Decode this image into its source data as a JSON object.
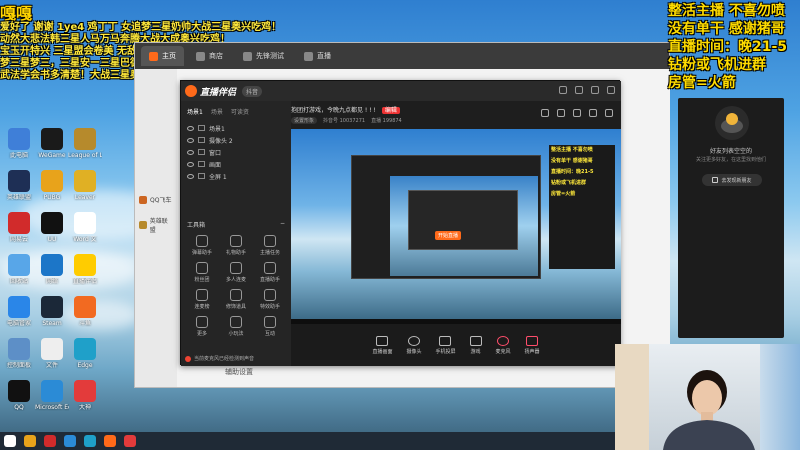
{
  "danmaku": [
    "爱好了 谢谢 1ye4 鸡丁丁 女追梦三星奶帅大战三星奥兴吃鸡！",
    "动然大悲法韩三星人马万马奔腾大战大成奥兴吃鸡！",
    "宝玉开特兴 三星盟会卷美 无敌9000血亚索一菜双吃鸡！！！",
    "梦三星梦三，三星安ー三星巴德奥兴吃鸡！",
    "武法学会书多清楚！大战三星奥兴吃鸡！"
  ],
  "danmaku_big": "嘎嘎",
  "desktop_icons": [
    {
      "label": "此电脑",
      "color": "#3f7fd8"
    },
    {
      "label": "WeGame",
      "color": "#1a1a1a"
    },
    {
      "label": "League of Legends",
      "color": "#b68a2c"
    },
    {
      "label": "英雄联盟",
      "color": "#1e2f55"
    },
    {
      "label": "PUBG",
      "color": "#e8a31b"
    },
    {
      "label": "Leaver",
      "color": "#e0b024"
    },
    {
      "label": "网易云",
      "color": "#d12b2b"
    },
    {
      "label": "UU",
      "color": "#111111"
    },
    {
      "label": "Word 文",
      "color": "#ffffff"
    },
    {
      "label": "回收站",
      "color": "#58a6e8"
    },
    {
      "label": "网络",
      "color": "#1c76c8"
    },
    {
      "label": "直播伴侣",
      "color": "#ffcc00"
    },
    {
      "label": "电脑管家",
      "color": "#2a86e8"
    },
    {
      "label": "Steam",
      "color": "#1b2838"
    },
    {
      "label": "斗鱼",
      "color": "#f26a21"
    },
    {
      "label": "控制面板",
      "color": "#5d8fc7"
    },
    {
      "label": "文件",
      "color": "#eeeeee"
    },
    {
      "label": "Edge",
      "color": "#1fa0c9"
    },
    {
      "label": "QQ",
      "color": "#111111"
    },
    {
      "label": "Microsoft Edge",
      "color": "#2b8bd6"
    },
    {
      "label": "大神",
      "color": "#e33b3b"
    }
  ],
  "browser": {
    "tabs": [
      {
        "label": "主页",
        "active": true,
        "color": "#ff6a1a"
      },
      {
        "label": "商店",
        "active": false,
        "color": "#888888"
      },
      {
        "label": "先锋测试",
        "active": false,
        "color": "#888888"
      },
      {
        "label": "直播",
        "active": false,
        "color": "#888888"
      }
    ],
    "side_items": [
      "QQ飞车",
      "英雄联盟"
    ],
    "footer": "辅助设置"
  },
  "app": {
    "title": "直播伴侣",
    "badge": "抖音",
    "scene_tabs": [
      "场景1",
      "场景",
      "可读资"
    ],
    "sources": [
      "场景1",
      "摄像头 2",
      "窗口",
      "画面",
      "全屏 1"
    ],
    "tools_title": "工具箱",
    "tools": [
      "弹幕助手",
      "礼物助手",
      "主播任务",
      "粉丝团",
      "多人连麦",
      "直播助手",
      "连麦榜",
      "修饰道具",
      "特效助手",
      "更多",
      "小玩法",
      "互动"
    ],
    "left_footer": "当前麦克风已经检测到声音",
    "stream_title": "抱团打游戏，今晚九点都见 ! ! !",
    "edit_label": "编辑",
    "meta": [
      "设置形象",
      "抖音号 10037271",
      "直播 199874"
    ],
    "preview_button": "开始直播",
    "bottom_buttons": [
      "直播画面",
      "摄像头",
      "手机投屏",
      "游戏",
      "麦克风",
      "扬声器"
    ]
  },
  "overlay": {
    "lines": [
      "整活主播 不喜勿喷",
      "没有单干 感谢猪哥",
      "直播时间：晚21-5",
      "钻粉或飞机进群",
      "房管=火箭"
    ],
    "panel_title": "好友列表空空的",
    "panel_sub": "关注更多好友，在这里找到他们",
    "panel_button": "去发现新朋友"
  },
  "taskbar_colors": [
    "#ffffff",
    "#e8a31b",
    "#d12b2b",
    "#2b8bd6",
    "#1fa0c9",
    "#ff6a1a",
    "#e33b3b"
  ]
}
